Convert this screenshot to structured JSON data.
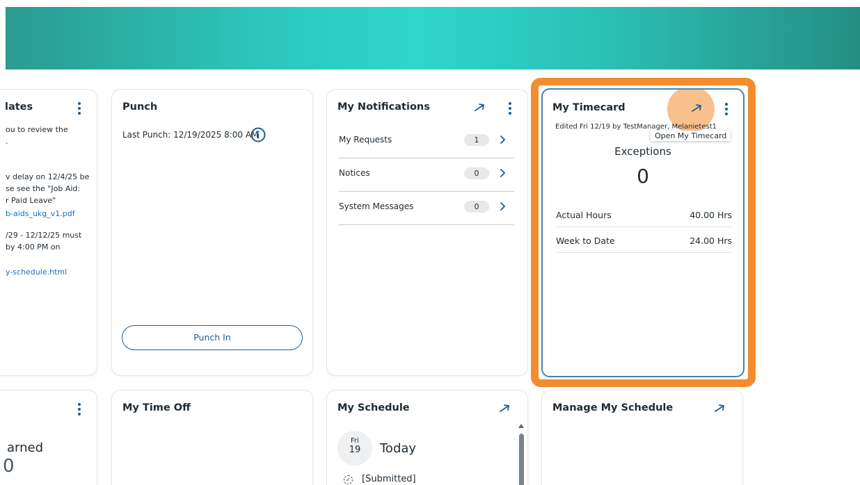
{
  "cards": {
    "updates": {
      "title": "lates",
      "lines": [
        "ou to review the",
        ".",
        "v delay on 12/4/25 be",
        "se see the \"Job Aid:",
        "r Paid Leave\""
      ],
      "link1": "b-aids_ukg_v1.pdf",
      "lines2": [
        "/29 - 12/12/25 must",
        "by 4:00 PM on"
      ],
      "link2": "y-schedule.html"
    },
    "punch": {
      "title": "Punch",
      "last_punch": "Last Punch: 12/19/2025 8:00 AM",
      "button_label": "Punch In"
    },
    "notifications": {
      "title": "My Notifications",
      "items": [
        {
          "label": "My Requests",
          "count": "1"
        },
        {
          "label": "Notices",
          "count": "0"
        },
        {
          "label": "System Messages",
          "count": "0"
        }
      ]
    },
    "timecard": {
      "title": "My Timecard",
      "edited": "Edited Fri 12/19 by TestManager, Melanietest1",
      "tooltip": "Open My Timecard",
      "exceptions_label": "Exceptions",
      "exceptions_value": "0",
      "rows": [
        {
          "label": "Actual Hours",
          "value": "40.00 Hrs"
        },
        {
          "label": "Week to Date",
          "value": "24.00 Hrs"
        }
      ]
    },
    "bottom_left": {
      "label": "arned",
      "value": "0"
    },
    "time_off": {
      "title": "My Time Off"
    },
    "schedule": {
      "title": "My Schedule",
      "day_name": "Fri",
      "day_num": "19",
      "today_label": "Today",
      "status": "[Submitted]"
    },
    "manage_schedule": {
      "title": "Manage My Schedule"
    }
  },
  "colors": {
    "accent": "#1e5c8f",
    "highlight": "#f28c2e",
    "banner": "#2ed6cc"
  }
}
